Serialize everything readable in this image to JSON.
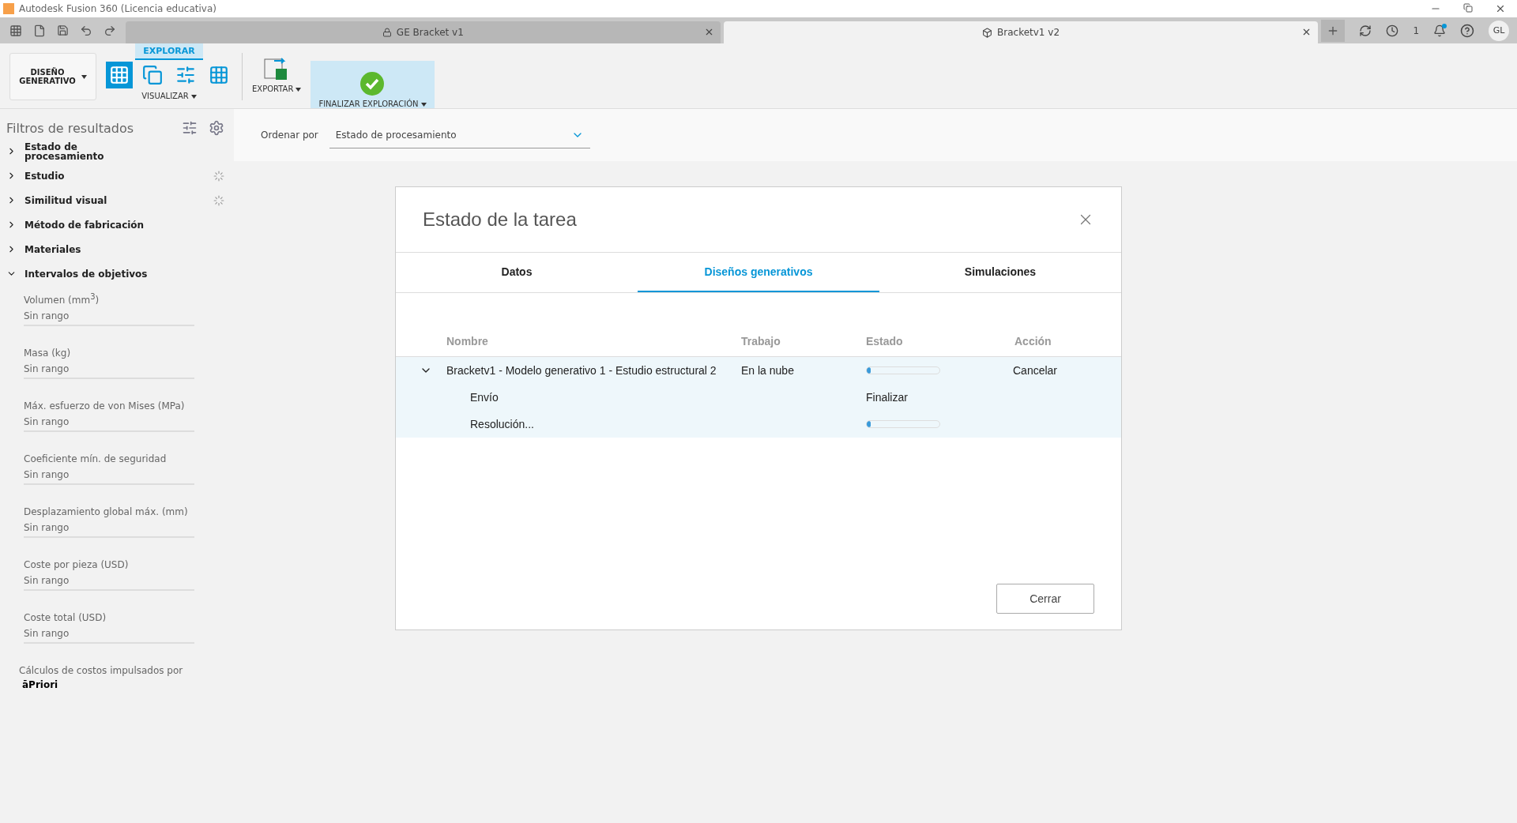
{
  "window": {
    "title": "Autodesk Fusion 360 (Licencia educativa)"
  },
  "doc_tabs": [
    {
      "label": "GE Bracket v1",
      "selected": false,
      "kind": "locked"
    },
    {
      "label": "Bracketv1 v2",
      "selected": true,
      "kind": "part"
    }
  ],
  "notifications": {
    "jobs": "1",
    "unread": true
  },
  "user": {
    "initials": "GL"
  },
  "toolbar": {
    "workspace": "DISEÑO\nGENERATIVO",
    "tab": "EXPLORAR",
    "groups": [
      "VISUALIZAR",
      "EXPORTAR",
      "FINALIZAR EXPLORACIÓN"
    ],
    "views": [
      {
        "selected": true
      },
      {
        "selected": false
      },
      {
        "selected": false
      },
      {
        "selected": false
      }
    ]
  },
  "sidebar": {
    "title": "Filtros de resultados",
    "filters": [
      {
        "label": "Estado de\nprocesamiento",
        "expanded": false,
        "loading": false
      },
      {
        "label": "Estudio",
        "expanded": false,
        "loading": true
      },
      {
        "label": "Similitud visual",
        "expanded": false,
        "loading": true
      },
      {
        "label": "Método de fabricación",
        "expanded": false,
        "loading": false
      },
      {
        "label": "Materiales",
        "expanded": false,
        "loading": false
      },
      {
        "label": "Intervalos de objetivos",
        "expanded": true,
        "loading": false
      }
    ],
    "ranges": [
      {
        "label": "Volumen (mm$^{3}$)",
        "value": "Sin rango"
      },
      {
        "label": "Masa (kg)",
        "value": "Sin rango"
      },
      {
        "label": "Máx. esfuerzo de von Mises (MPa)",
        "value": "Sin rango"
      },
      {
        "label": "Coeficiente mín. de seguridad",
        "value": "Sin rango"
      },
      {
        "label": "Desplazamiento global máx. (mm)",
        "value": "Sin rango"
      },
      {
        "label": "Coste por pieza (USD)",
        "value": "Sin rango"
      },
      {
        "label": "Coste total (USD)",
        "value": "Sin rango"
      }
    ],
    "credit": "Cálculos de costos impulsados por",
    "credit_brand": "āPriori"
  },
  "sort": {
    "label": "Ordenar por",
    "value": "Estado de procesamiento"
  },
  "dialog": {
    "title": "Estado de la tarea",
    "tabs": [
      {
        "label": "Datos",
        "selected": false
      },
      {
        "label": "Diseños generativos",
        "selected": true
      },
      {
        "label": "Simulaciones",
        "selected": false
      }
    ],
    "columns": [
      "Nombre",
      "Trabajo",
      "Estado",
      "Acción"
    ],
    "rows": [
      {
        "name": "Bracketv1 - Modelo generativo 1 - Estudio estructural 2",
        "job": "En la nube",
        "level": 0.05,
        "action": "Cancelar",
        "expanded": true,
        "children": [
          {
            "name": "Envío",
            "status": "Finalizar"
          },
          {
            "name": "Resolución...",
            "level": 0.05
          }
        ]
      }
    ],
    "close_button": "Cerrar"
  }
}
